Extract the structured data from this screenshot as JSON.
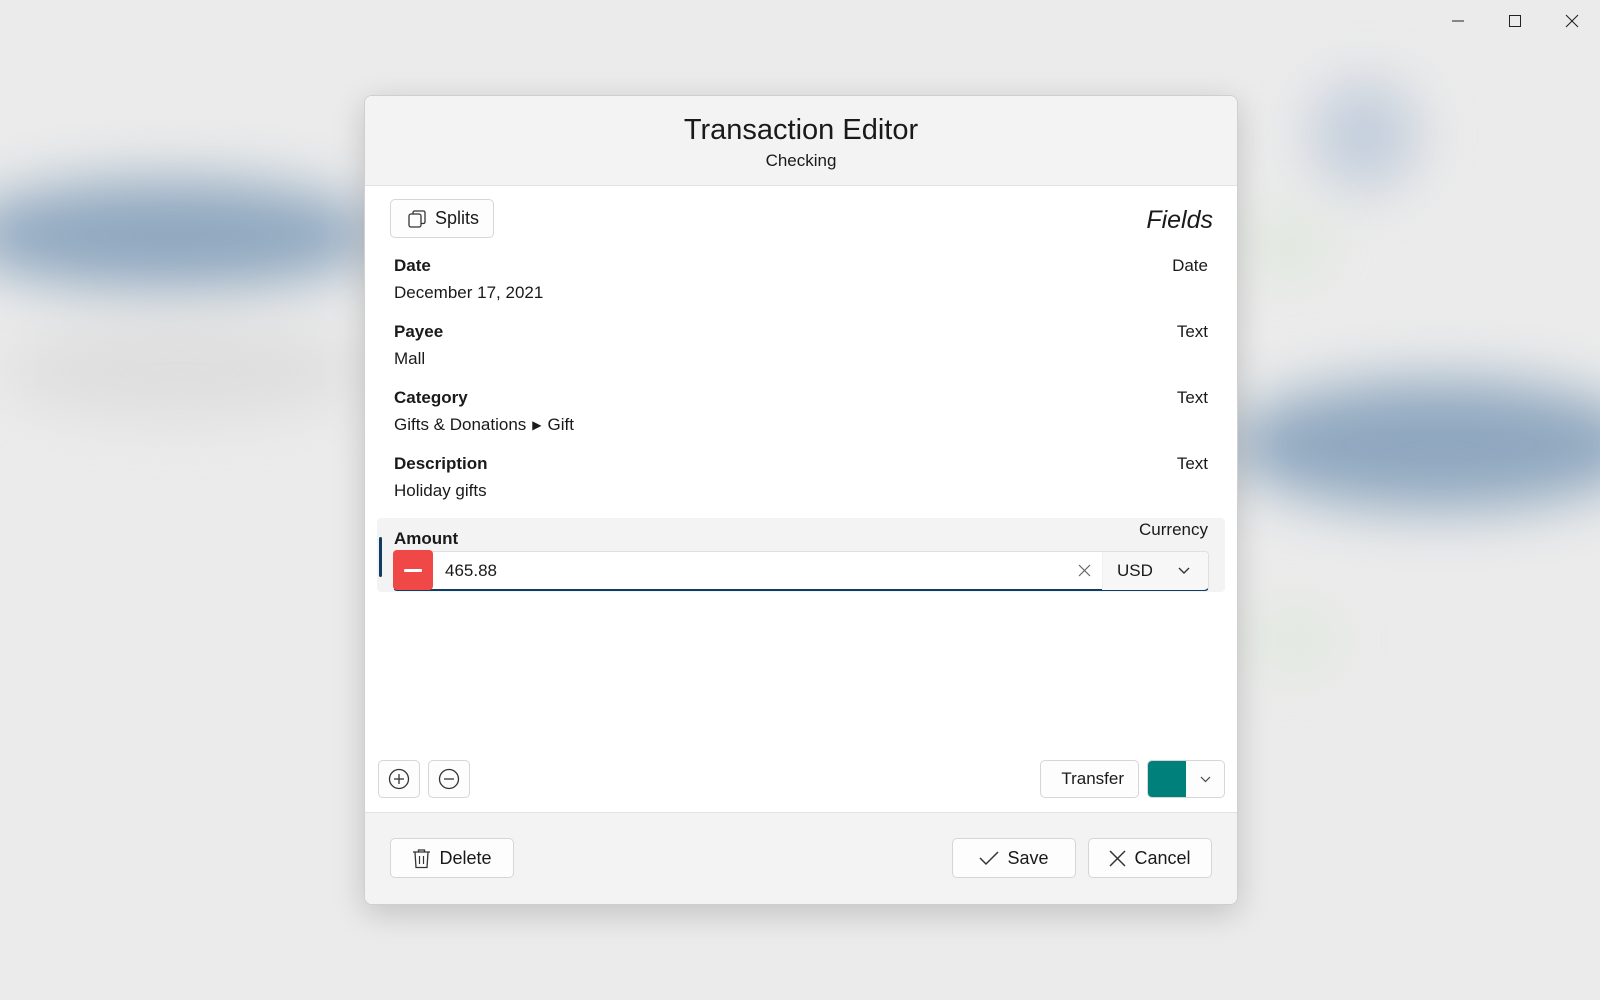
{
  "dialog": {
    "title": "Transaction Editor",
    "subtitle": "Checking",
    "splits_label": "Splits",
    "fields_heading": "Fields"
  },
  "fields": [
    {
      "label": "Date",
      "type": "Date",
      "value": "December 17, 2021"
    },
    {
      "label": "Payee",
      "type": "Text",
      "value": "Mall"
    },
    {
      "label": "Category",
      "type": "Text",
      "value_parent": "Gifts & Donations",
      "value_separator": "▶",
      "value_child": "Gift"
    },
    {
      "label": "Description",
      "type": "Text",
      "value": "Holiday gifts"
    },
    {
      "label": "Amount",
      "type": "Currency",
      "value": "465.88",
      "currency": "USD"
    }
  ],
  "toolbar": {
    "add_icon": "plus-circle-icon",
    "remove_icon": "minus-circle-icon",
    "transfer_label": "Transfer",
    "color": "#00807a"
  },
  "footer": {
    "delete_label": "Delete",
    "save_label": "Save",
    "cancel_label": "Cancel"
  },
  "colors": {
    "accent": "#0f3d63",
    "negative": "#f04747",
    "swatch": "#00807a"
  }
}
